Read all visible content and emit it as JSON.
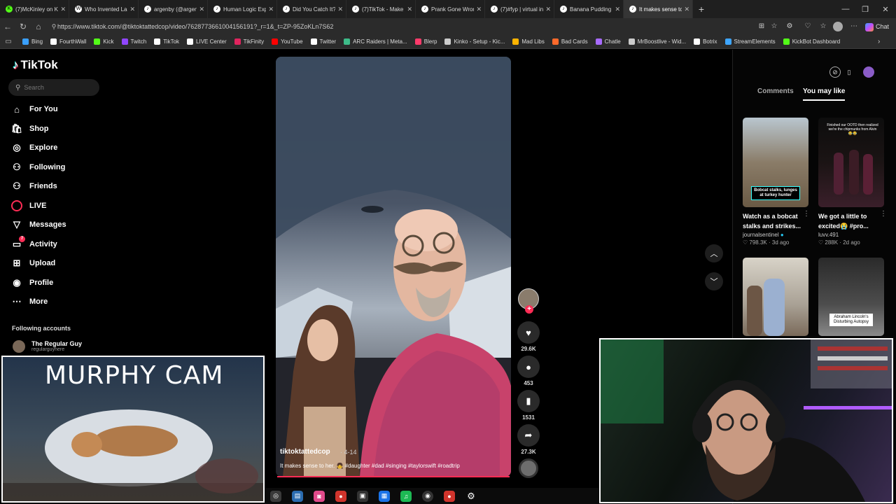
{
  "browser": {
    "tabs": [
      {
        "title": "(7)McKinley on Kick (@",
        "favicon": "K",
        "color": "#53fc18"
      },
      {
        "title": "Who Invented Lasso Pa",
        "favicon": "W",
        "color": "#ffffff"
      },
      {
        "title": "argenby (@argenby)'s",
        "favicon": "♪",
        "color": "#ffffff"
      },
      {
        "title": "Human Logic Explaine",
        "favicon": "♪",
        "color": "#ffffff"
      },
      {
        "title": "Did You Catch It? Sens",
        "favicon": "♪",
        "color": "#ffffff"
      },
      {
        "title": "(7)TikTok - Make Your",
        "favicon": "♪",
        "color": "#ffffff"
      },
      {
        "title": "Prank Gone Wrong: Re",
        "favicon": "♪",
        "color": "#ffffff"
      },
      {
        "title": "(7)#fyp | virtual insanit",
        "favicon": "♪",
        "color": "#ffffff"
      },
      {
        "title": "Banana Pudding Nach",
        "favicon": "♪",
        "color": "#ffffff"
      },
      {
        "title": "It makes sense to",
        "favicon": "♪",
        "color": "#ffffff",
        "active": true
      }
    ],
    "url": "https://www.tiktok.com/@tiktoktattedcop/video/7628773661004156191?_r=1&_t=ZP-95ZoKLn7S62",
    "chat_label": "Chat",
    "bookmarks": [
      {
        "label": "Bing",
        "icon": "bing-icon",
        "color": "#3aa0ff"
      },
      {
        "label": "FourthWall",
        "icon": "fourthwall-icon",
        "color": "#ffffff"
      },
      {
        "label": "Kick",
        "icon": "kick-icon",
        "color": "#53fc18"
      },
      {
        "label": "Twitch",
        "icon": "twitch-icon",
        "color": "#9146ff"
      },
      {
        "label": "TikTok",
        "icon": "tiktok-icon",
        "color": "#ffffff"
      },
      {
        "label": "LIVE Center",
        "icon": "tiktok-icon",
        "color": "#ffffff"
      },
      {
        "label": "TikFinity",
        "icon": "tikfinity-icon",
        "color": "#e0245e"
      },
      {
        "label": "YouTube",
        "icon": "youtube-icon",
        "color": "#ff0000"
      },
      {
        "label": "Twitter",
        "icon": "x-icon",
        "color": "#ffffff"
      },
      {
        "label": "ARC Raiders | Meta...",
        "icon": "arc-icon",
        "color": "#3dbb88"
      },
      {
        "label": "Blerp",
        "icon": "blerp-icon",
        "color": "#ff3b6b"
      },
      {
        "label": "Kinko - Setup - Kic...",
        "icon": "kinko-icon",
        "color": "#cccccc"
      },
      {
        "label": "Mad Libs",
        "icon": "madlibs-icon",
        "color": "#ffb400"
      },
      {
        "label": "Bad Cards",
        "icon": "badcards-icon",
        "color": "#ff6a2b"
      },
      {
        "label": "Chatle",
        "icon": "chatle-icon",
        "color": "#a86bff"
      },
      {
        "label": "MrBoostlive - Wid...",
        "icon": "boost-icon",
        "color": "#cccccc"
      },
      {
        "label": "Botrix",
        "icon": "botrix-icon",
        "color": "#ffffff"
      },
      {
        "label": "StreamElements",
        "icon": "streamelements-icon",
        "color": "#3ea6ff"
      },
      {
        "label": "KickBot Dashboard",
        "icon": "kickbot-icon",
        "color": "#53fc18"
      }
    ]
  },
  "tiktok": {
    "logo": "TikTok",
    "search_placeholder": "Search",
    "nav": [
      {
        "label": "For You",
        "icon": "home-icon"
      },
      {
        "label": "Shop",
        "icon": "shop-icon"
      },
      {
        "label": "Explore",
        "icon": "compass-icon"
      },
      {
        "label": "Following",
        "icon": "following-icon"
      },
      {
        "label": "Friends",
        "icon": "friends-icon"
      },
      {
        "label": "LIVE",
        "icon": "live-icon"
      },
      {
        "label": "Messages",
        "icon": "messages-icon"
      },
      {
        "label": "Activity",
        "icon": "activity-icon",
        "badge": "7"
      },
      {
        "label": "Upload",
        "icon": "upload-icon"
      },
      {
        "label": "Profile",
        "icon": "profile-icon"
      },
      {
        "label": "More",
        "icon": "more-icon"
      }
    ],
    "following_title": "Following accounts",
    "following_accounts": [
      {
        "name": "The Regular Guy",
        "handle": "regularguyhere"
      }
    ],
    "video": {
      "author": "tiktoktattedcop",
      "date": "· 4-14",
      "caption": "It makes sense to her. 👧 #daughter #dad #singing #taylorswift #roadtrip",
      "likes": "29.6K",
      "comments": "453",
      "saves": "1531",
      "shares": "27.3K"
    },
    "panel": {
      "tab_comments": "Comments",
      "tab_you_may_like": "You may like",
      "cards": [
        {
          "title": "Watch as a bobcat stalks and strikes...",
          "user": "journalsentinel",
          "verified": true,
          "likes": "798.3K",
          "age": "3d ago",
          "overlay": "Bobcat stalks, lunges at turkey hunter"
        },
        {
          "title": "We got a little to excited😭 #pro...",
          "user": "luvv.491",
          "verified": false,
          "likes": "288K",
          "age": "2d ago",
          "overlay": "Finished our OOTD then realized we're the chipmunks from Alvin 😂😂"
        },
        {
          "title": "",
          "user": "",
          "overlay": ""
        },
        {
          "title": "",
          "user": "",
          "overlay": "Abraham Lincoln's Disturbing Autopsy"
        }
      ]
    }
  },
  "overlays": {
    "murphy_title": "MURPHY CAM"
  }
}
